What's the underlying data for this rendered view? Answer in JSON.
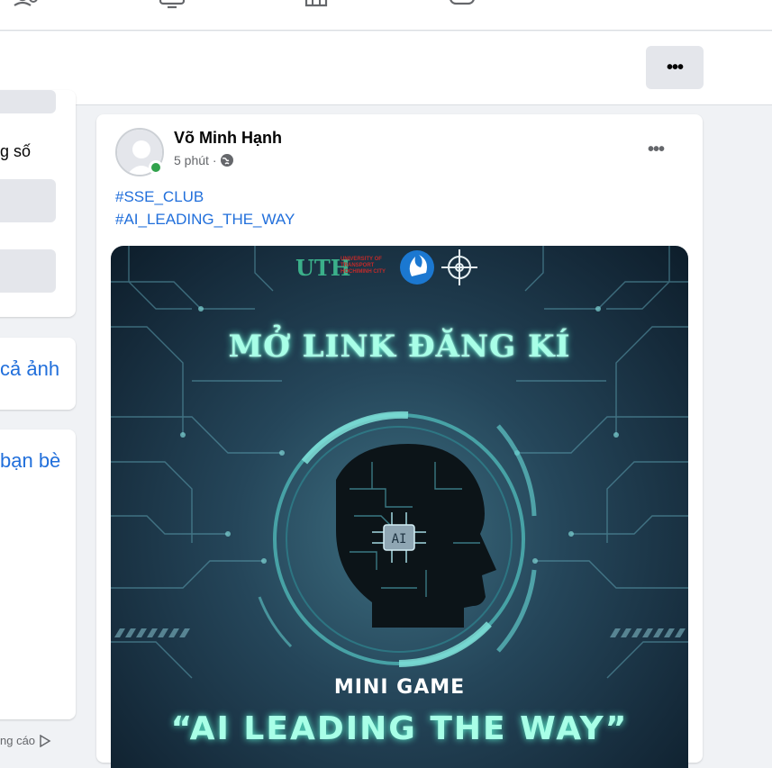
{
  "topnav": {
    "icons": [
      "friends-icon",
      "watch-icon",
      "marketplace-icon",
      "gaming-icon"
    ]
  },
  "subbar": {
    "more_label": "•••"
  },
  "left": {
    "snippet_1": "g số",
    "link_photos": "cả ảnh",
    "link_friends": "bạn bè",
    "footer": "ng cáo"
  },
  "post": {
    "author": "Võ Minh Hạnh",
    "time": "5 phút ·",
    "more_label": "•••",
    "hashtags": [
      "#SSE_CLUB",
      "#AI_LEADING_THE_WAY"
    ],
    "poster": {
      "logo_text": "UTH",
      "logo_subtext": "UNIVERSITY OF TRANSPORT HOCHIMINH CITY",
      "headline": "MỞ LINK ĐĂNG KÍ",
      "ai_chip": "AI",
      "subtitle": "MINI GAME",
      "tagline": "“AI LEADING THE WAY”"
    }
  },
  "colors": {
    "link": "#216fdb",
    "online": "#31a24c",
    "glow": "#a8ffe7"
  }
}
